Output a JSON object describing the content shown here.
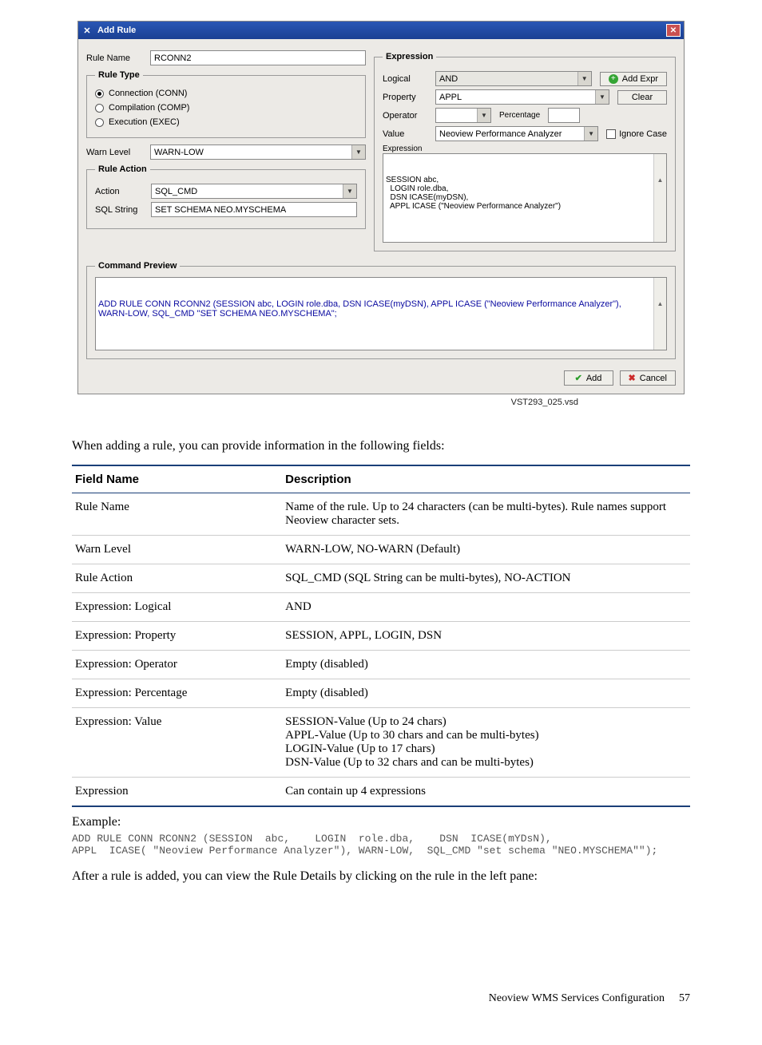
{
  "dialog": {
    "title": "Add Rule",
    "ruleNameLabel": "Rule Name",
    "ruleNameValue": "RCONN2",
    "rule_type": {
      "legend": "Rule Type",
      "options": [
        {
          "label": "Connection (CONN)",
          "selected": true
        },
        {
          "label": "Compilation (COMP)",
          "selected": false
        },
        {
          "label": "Execution (EXEC)",
          "selected": false
        }
      ]
    },
    "warnLevelLabel": "Warn Level",
    "warnLevelValue": "WARN-LOW",
    "rule_action": {
      "legend": "Rule Action",
      "actionLabel": "Action",
      "actionValue": "SQL_CMD",
      "sqlLabel": "SQL String",
      "sqlValue": "SET SCHEMA NEO.MYSCHEMA"
    },
    "expression": {
      "legend": "Expression",
      "logicalLabel": "Logical",
      "logicalValue": "AND",
      "addExprLabel": "Add Expr",
      "propertyLabel": "Property",
      "propertyValue": "APPL",
      "clearLabel": "Clear",
      "operatorLabel": "Operator",
      "operatorValue": "",
      "percentageLabel": "Percentage",
      "percentageValue": "",
      "valueLabel": "Value",
      "valueValue": "Neoview Performance Analyzer",
      "ignoreCaseLabel": "Ignore Case",
      "exprLabel": "Expression",
      "exprText": "SESSION abc,\n  LOGIN role.dba,\n  DSN ICASE(myDSN),\n  APPL ICASE (\"Neoview Performance Analyzer\")"
    },
    "cmdPreview": {
      "legend": "Command Preview",
      "text": "ADD RULE CONN RCONN2 (SESSION abc,  LOGIN role.dba,  DSN ICASE(myDSN),  APPL ICASE (\"Neoview Performance Analyzer\"), WARN-LOW, SQL_CMD \"SET SCHEMA NEO.MYSCHEMA\";"
    },
    "addBtn": "Add",
    "cancelBtn": "Cancel"
  },
  "vsdcap": "VST293_025.vsd",
  "intro": "When adding a rule, you can provide information in the following fields:",
  "table": {
    "h1": "Field Name",
    "h2": "Description",
    "rows": [
      {
        "name": "Rule Name",
        "desc": "Name of the rule. Up to 24 characters (can be multi-bytes). Rule names support Neoview character sets."
      },
      {
        "name": "Warn Level",
        "desc": "WARN-LOW, NO-WARN (Default)"
      },
      {
        "name": "Rule Action",
        "desc": "SQL_CMD (SQL String can be multi-bytes), NO-ACTION"
      },
      {
        "name": "Expression: Logical",
        "desc": "AND"
      },
      {
        "name": "Expression: Property",
        "desc": "SESSION, APPL, LOGIN, DSN"
      },
      {
        "name": "Expression: Operator",
        "desc": "Empty (disabled)"
      },
      {
        "name": "Expression: Percentage",
        "desc": "Empty (disabled)"
      },
      {
        "name": "Expression: Value",
        "desc": "SESSION-Value (Up to 24 chars)\nAPPL-Value (Up to 30 chars and can be multi-bytes)\nLOGIN-Value (Up to 17 chars)\nDSN-Value (Up to 32 chars and can be multi-bytes)"
      },
      {
        "name": "Expression",
        "desc": "Can contain up 4 expressions"
      }
    ]
  },
  "exampleHead": "Example:",
  "code": "ADD RULE CONN RCONN2 (SESSION  abc,    LOGIN  role.dba,    DSN  ICASE(mYDsN),\nAPPL  ICASE( \"Neoview Performance Analyzer\"), WARN-LOW,  SQL_CMD \"set schema \"NEO.MYSCHEMA\"\");",
  "afterText": "After a rule is added, you can view the Rule Details by clicking on the rule in the left pane:",
  "footer": {
    "title": "Neoview WMS Services Configuration",
    "page": "57"
  }
}
